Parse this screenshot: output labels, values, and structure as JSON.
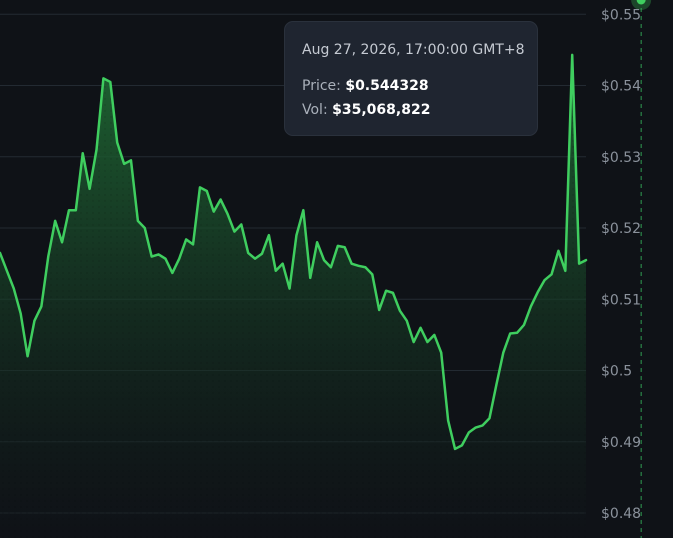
{
  "colors": {
    "background": "#0f1217",
    "line": "#3fce5f",
    "area_top": "#1f6a34",
    "grid": "#232a32",
    "crosshair": "#2f9e52",
    "axis_text": "#8b929c",
    "tooltip_bg": "#1f2530"
  },
  "tooltip": {
    "date": "Aug 27, 2026, 17:00:00 GMT+8",
    "price_label": "Price:",
    "price_value": "$0.544328",
    "vol_label": "Vol:",
    "vol_value": "$35,068,822"
  },
  "chart_data": {
    "type": "area",
    "y_ticks": [
      "$0.55",
      "$0.54",
      "$0.53",
      "$0.52",
      "$0.51",
      "$0.5",
      "$0.49",
      "$0.48"
    ],
    "y_tick_values": [
      0.55,
      0.54,
      0.53,
      0.52,
      0.51,
      0.5,
      0.49,
      0.48
    ],
    "ylim": [
      0.4765,
      0.552
    ],
    "y_axis_position": "right",
    "grid": true,
    "highlighted_index": 93,
    "series": [
      {
        "values": [
          0.5165,
          0.514,
          0.5115,
          0.508,
          0.502,
          0.507,
          0.509,
          0.516,
          0.521,
          0.518,
          0.5225,
          0.5225,
          0.5305,
          0.5255,
          0.531,
          0.541,
          0.5405,
          0.532,
          0.529,
          0.5295,
          0.521,
          0.52,
          0.516,
          0.5163,
          0.5157,
          0.5137,
          0.5157,
          0.5184,
          0.5177,
          0.5257,
          0.5252,
          0.5223,
          0.524,
          0.522,
          0.5195,
          0.5205,
          0.5165,
          0.5157,
          0.5164,
          0.519,
          0.514,
          0.515,
          0.5115,
          0.519,
          0.5225,
          0.513,
          0.518,
          0.5155,
          0.5145,
          0.5175,
          0.5173,
          0.515,
          0.5147,
          0.5145,
          0.5135,
          0.5085,
          0.5112,
          0.5109,
          0.5084,
          0.507,
          0.504,
          0.506,
          0.504,
          0.505,
          0.5025,
          0.493,
          0.489,
          0.4895,
          0.4913,
          0.492,
          0.4923,
          0.4933,
          0.498,
          0.5025,
          0.5052,
          0.5053,
          0.5064,
          0.509,
          0.511,
          0.5127,
          0.5135,
          0.5168,
          0.514,
          0.5443,
          0.515,
          0.5155
        ]
      }
    ]
  }
}
